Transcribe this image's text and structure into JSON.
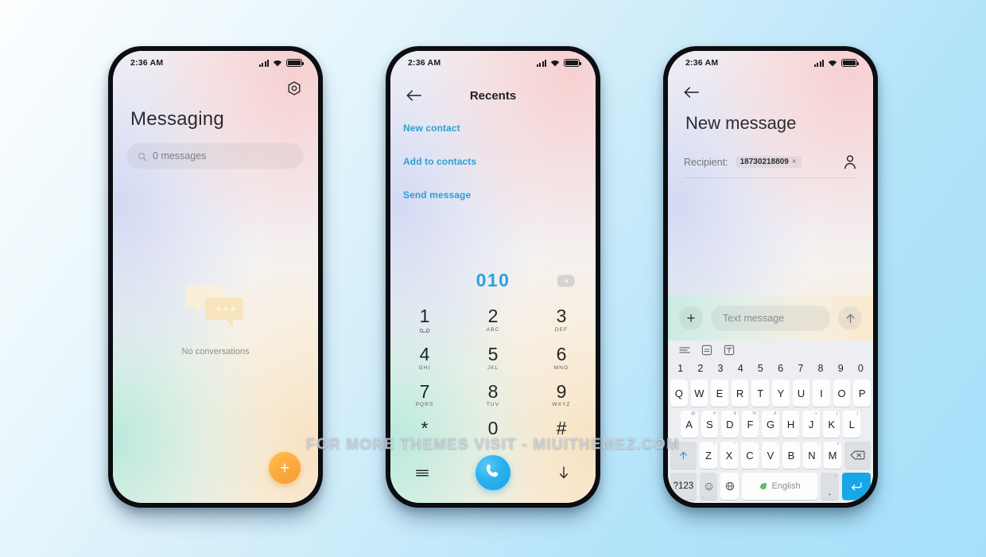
{
  "watermark": "FOR MORE THEMES VISIT - MIUITHEMEZ.COM",
  "status_bar": {
    "time": "2:36 AM",
    "signal_icon": "signal-bars-icon",
    "wifi_icon": "wifi-icon",
    "battery_icon": "battery-icon"
  },
  "phone1": {
    "settings_icon": "settings-gear-icon",
    "title": "Messaging",
    "search": {
      "icon": "search-icon",
      "placeholder": "0 messages",
      "value": ""
    },
    "empty_state": {
      "icon": "chat-bubbles-icon",
      "text": "No conversations"
    },
    "fab": {
      "label": "+",
      "name": "new-message-fab",
      "color": "#fcab3f"
    }
  },
  "phone2": {
    "back_icon": "back-arrow-icon",
    "title": "Recents",
    "quick_actions": [
      "New contact",
      "Add to contacts",
      "Send message"
    ],
    "dialed_number": "010",
    "backspace_icon": "backspace-icon",
    "accent_color": "#2aa3dd",
    "keys": [
      {
        "digit": "1",
        "sub": "",
        "icon": "voicemail-icon"
      },
      {
        "digit": "2",
        "sub": "ABC",
        "icon": ""
      },
      {
        "digit": "3",
        "sub": "DEF",
        "icon": ""
      },
      {
        "digit": "4",
        "sub": "GHI",
        "icon": ""
      },
      {
        "digit": "5",
        "sub": "JKL",
        "icon": ""
      },
      {
        "digit": "6",
        "sub": "MNO",
        "icon": ""
      },
      {
        "digit": "7",
        "sub": "PQRS",
        "icon": ""
      },
      {
        "digit": "8",
        "sub": "TUV",
        "icon": ""
      },
      {
        "digit": "9",
        "sub": "WXYZ",
        "icon": ""
      },
      {
        "digit": "*",
        "sub": "",
        "icon": ""
      },
      {
        "digit": "0",
        "sub": "",
        "icon": ""
      },
      {
        "digit": "#",
        "sub": "",
        "icon": ""
      }
    ],
    "bottom": {
      "menu_icon": "menu-icon",
      "call_icon": "phone-call-icon",
      "hide_icon": "arrow-down-icon"
    }
  },
  "phone3": {
    "back_icon": "back-arrow-icon",
    "title": "New message",
    "recipient": {
      "label": "Recipient:",
      "chip": "18730218809",
      "remove": "×",
      "picker_icon": "contact-person-icon"
    },
    "composer": {
      "add_icon": "plus-icon",
      "placeholder": "Text message",
      "value": "",
      "send_icon": "send-arrow-up-icon"
    },
    "keyboard": {
      "toolbar": [
        "menu-lines-icon",
        "clipboard-icon",
        "text-format-icon"
      ],
      "number_row": [
        "1",
        "2",
        "3",
        "4",
        "5",
        "6",
        "7",
        "8",
        "9",
        "0"
      ],
      "row1": [
        {
          "key": "Q",
          "sup": ""
        },
        {
          "key": "W",
          "sup": ""
        },
        {
          "key": "E",
          "sup": ""
        },
        {
          "key": "R",
          "sup": ""
        },
        {
          "key": "T",
          "sup": ""
        },
        {
          "key": "Y",
          "sup": ""
        },
        {
          "key": "U",
          "sup": ""
        },
        {
          "key": "I",
          "sup": ""
        },
        {
          "key": "O",
          "sup": ""
        },
        {
          "key": "P",
          "sup": ""
        }
      ],
      "row2": [
        {
          "key": "A",
          "sup": "@"
        },
        {
          "key": "S",
          "sup": "#"
        },
        {
          "key": "D",
          "sup": "$"
        },
        {
          "key": "F",
          "sup": "%"
        },
        {
          "key": "G",
          "sup": "&"
        },
        {
          "key": "H",
          "sup": "-"
        },
        {
          "key": "J",
          "sup": "+"
        },
        {
          "key": "K",
          "sup": "("
        },
        {
          "key": "L",
          "sup": ")"
        }
      ],
      "row3": [
        {
          "key": "Z",
          "sup": "*"
        },
        {
          "key": "X",
          "sup": "\""
        },
        {
          "key": "C",
          "sup": "'"
        },
        {
          "key": "V",
          "sup": ":"
        },
        {
          "key": "B",
          "sup": ";"
        },
        {
          "key": "N",
          "sup": "!"
        },
        {
          "key": "M",
          "sup": "?"
        }
      ],
      "shift_icon": "shift-arrow-up-icon",
      "backspace_icon": "backspace-icon",
      "symbols_key": "?123",
      "emoji_key": {
        "icon": "emoji-icon",
        "sub": ","
      },
      "globe_key": "globe-icon",
      "space_key": {
        "icon": "leaf-icon",
        "label": "English"
      },
      "period_key": {
        "label": ".",
        "sup": "♪"
      },
      "enter_key": "enter-arrow-icon",
      "enter_color": "#17a7e8"
    }
  }
}
